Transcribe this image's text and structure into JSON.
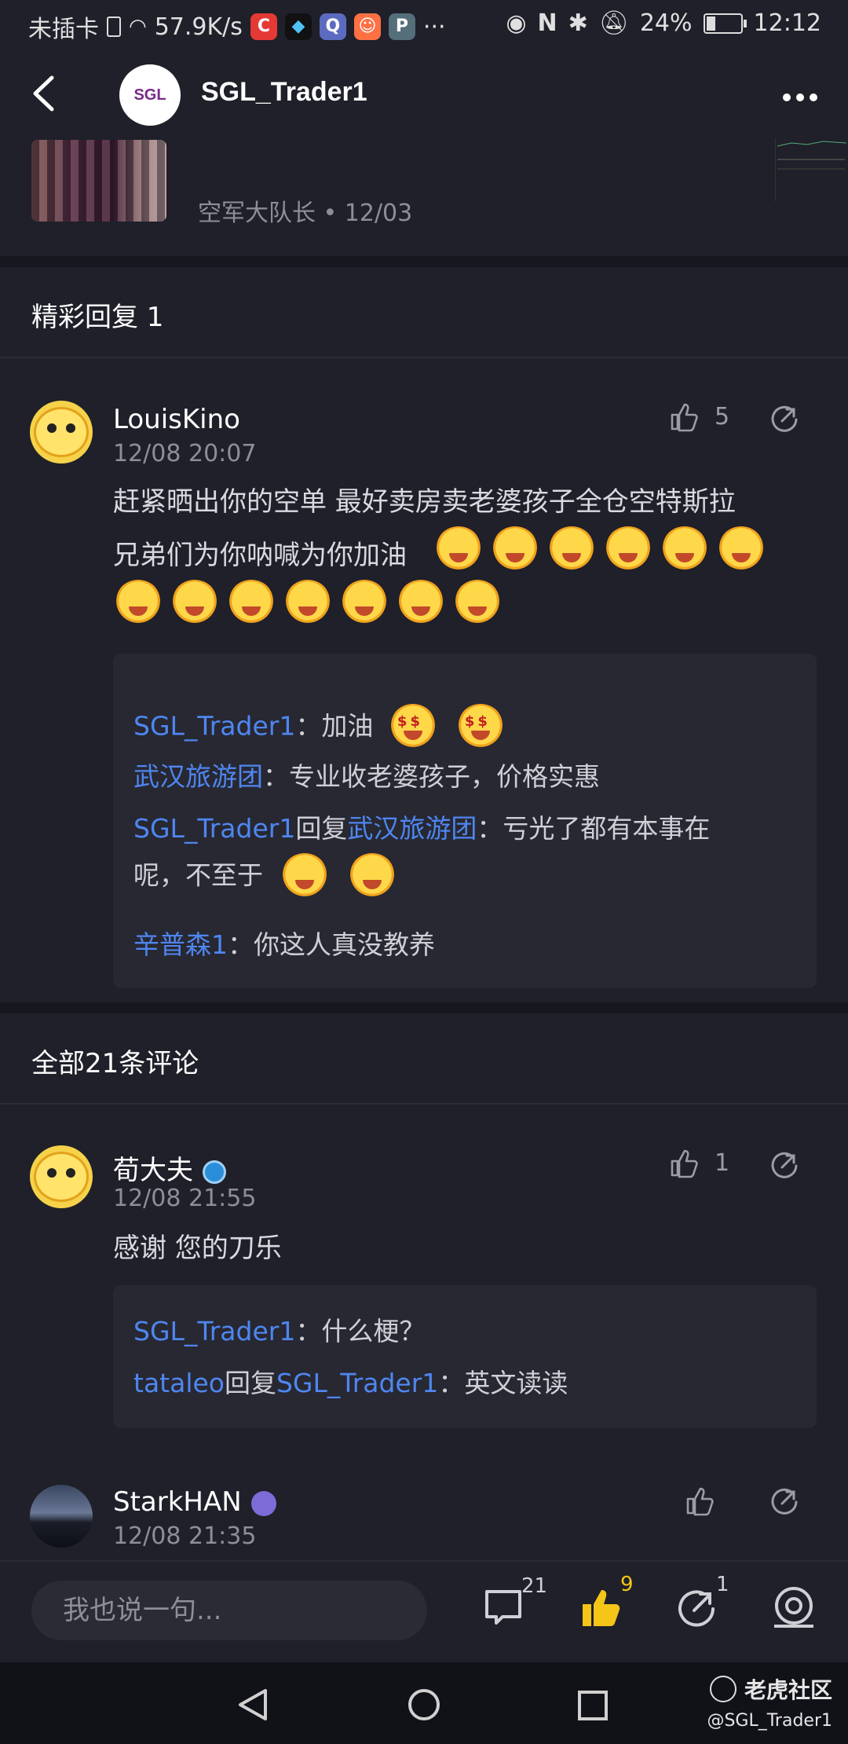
{
  "status_bar": {
    "carrier": "未插卡",
    "speed": "57.9K/s",
    "overflow": "···",
    "battery": "24%",
    "time": "12:12",
    "app_icons": [
      "C",
      "◆",
      "Q",
      "☺",
      "P"
    ]
  },
  "header": {
    "title": "SGL_Trader1",
    "avatar_text": "SGL"
  },
  "post": {
    "meta": "空军大队长 • 12/03"
  },
  "featured": {
    "title": "精彩回复 1"
  },
  "comment1": {
    "user": "LouisKino",
    "time": "12/08 20:07",
    "likes": "5",
    "line1": "赶紧晒出你的空单 最好卖房卖老婆孩子全仓空特斯拉",
    "line2": "兄弟们为你呐喊为你加油",
    "replies": {
      "r1_user": "SGL_Trader1",
      "r1_text": "：加油",
      "r2_user": "武汉旅游团",
      "r2_text": "：专业收老婆孩子，价格实惠",
      "r3_user": "SGL_Trader1",
      "r3_mid": "回复",
      "r3_target": "武汉旅游团",
      "r3_text": "：亏光了都有本事在",
      "r3_cont": "呢，不至于",
      "r4_user": "辛普森1",
      "r4_text": "：你这人真没教养"
    }
  },
  "all_comments": {
    "title": "全部21条评论"
  },
  "comment2": {
    "user": "荀大夫",
    "time": "12/08 21:55",
    "likes": "1",
    "text": "感谢 您的刀乐",
    "replies": {
      "r1_user": "SGL_Trader1",
      "r1_text": "：什么梗？",
      "r2_user": "tataleo",
      "r2_mid": "回复",
      "r2_target": "SGL_Trader1",
      "r2_text": "：英文读读"
    }
  },
  "comment3": {
    "user": "StarkHAN",
    "time": "12/08 21:35"
  },
  "bottom_bar": {
    "placeholder": "我也说一句...",
    "comments_count": "21",
    "likes_count": "9",
    "shares_count": "1"
  },
  "watermark": {
    "brand": "老虎社区",
    "handle": "@SGL_Trader1"
  },
  "colors": {
    "background": "#1f2029",
    "link": "#4f86f0",
    "like_active": "#f5c518"
  }
}
